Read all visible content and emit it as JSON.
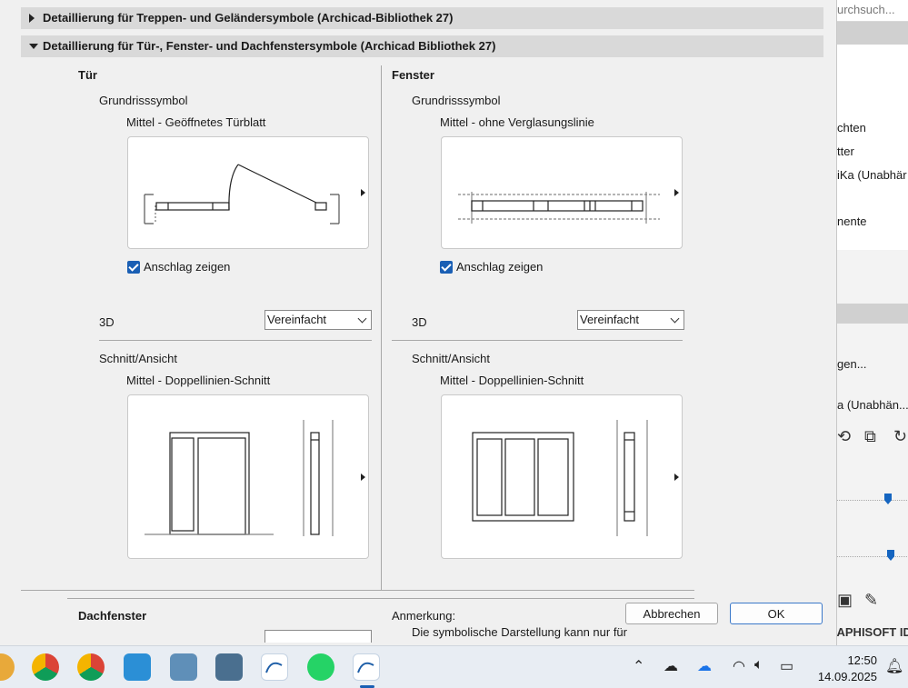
{
  "background_app": {
    "search_text": "urchsuch...",
    "list_items": [
      "chten",
      "tter",
      "iKa (Unabhär",
      "nente"
    ],
    "lower_items": [
      "gen...",
      "a (Unabhän..."
    ],
    "brand_text": "GRAPHISOFT ID"
  },
  "dialog": {
    "sections": {
      "stairs": "Detaillierung für Treppen- und Geländersymbole (Archicad-Bibliothek 27)",
      "doors_windows": "Detaillierung für Tür-, Fenster- und Dachfenstersymbole (Archicad Bibliothek 27)"
    },
    "door": {
      "title": "Tür",
      "plan_label": "Grundrisssymbol",
      "plan_value": "Mittel - Geöffnetes Türblatt",
      "checkbox_label": "Anschlag zeigen",
      "checkbox_checked": true,
      "label_3d": "3D",
      "select_3d": "Vereinfacht",
      "section_label": "Schnitt/Ansicht",
      "section_value": "Mittel - Doppellinien-Schnitt"
    },
    "window": {
      "title": "Fenster",
      "plan_label": "Grundrisssymbol",
      "plan_value": "Mittel - ohne Verglasungslinie",
      "checkbox_label": "Anschlag zeigen",
      "checkbox_checked": true,
      "label_3d": "3D",
      "select_3d": "Vereinfacht",
      "section_label": "Schnitt/Ansicht",
      "section_value": "Mittel - Doppellinien-Schnitt"
    },
    "skylight": {
      "title": "Dachfenster"
    },
    "note": {
      "label": "Anmerkung:",
      "text": "Die symbolische Darstellung kann nur für"
    },
    "buttons": {
      "cancel": "Abbrechen",
      "ok": "OK"
    }
  },
  "taskbar": {
    "time": "12:50",
    "date": "14.09.2025",
    "apps": [
      "chrome-icon",
      "chrome-icon",
      "stack-app-icon",
      "remote-desktop-icon",
      "calculator-icon",
      "archicad-icon",
      "whatsapp-icon",
      "archicad-active-icon"
    ]
  }
}
